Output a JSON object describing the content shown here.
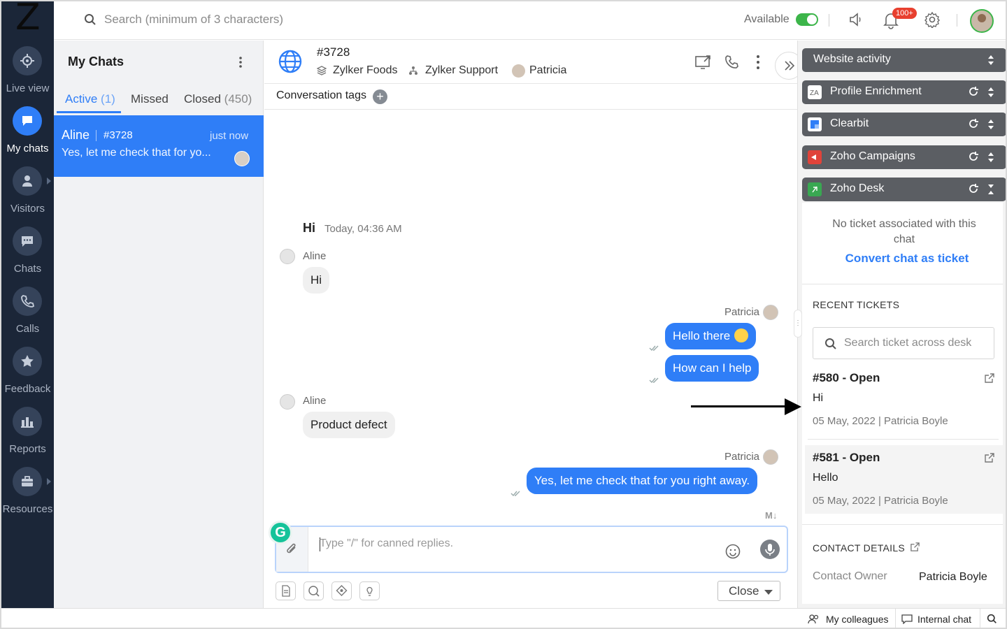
{
  "app": {
    "logo_letter": "Z"
  },
  "nav": {
    "items": [
      {
        "label": "Live view",
        "icon": "crosshair-icon"
      },
      {
        "label": "My chats",
        "icon": "chat-bubble-icon",
        "active": true
      },
      {
        "label": "Visitors",
        "icon": "person-icon"
      },
      {
        "label": "Chats",
        "icon": "chat-bubble-icon"
      },
      {
        "label": "Calls",
        "icon": "phone-icon"
      },
      {
        "label": "Feedback",
        "icon": "star-icon"
      },
      {
        "label": "Reports",
        "icon": "bar-chart-icon"
      },
      {
        "label": "Resources",
        "icon": "briefcase-icon"
      }
    ]
  },
  "topbar": {
    "search_placeholder": "Search (minimum of 3 characters)",
    "status_label": "Available",
    "status_on": true,
    "notification_badge": "100+"
  },
  "chatlist": {
    "title": "My Chats",
    "tabs": [
      {
        "label": "Active",
        "count": "(1)",
        "active": true
      },
      {
        "label": "Missed",
        "count": ""
      },
      {
        "label": "Closed",
        "count": "(450)"
      }
    ],
    "chats": [
      {
        "name": "Aline",
        "id": "#3728",
        "time": "just now",
        "preview": "Yes, let me check that for yo..."
      }
    ]
  },
  "conversation": {
    "id": "#3728",
    "brand": "Zylker Foods",
    "department": "Zylker Support",
    "agent": "Patricia",
    "tags_label": "Conversation tags",
    "day_greeting": "Hi",
    "day_time": "Today, 04:36 AM",
    "messages": [
      {
        "from": "Aline",
        "text": "Hi",
        "direction": "in"
      },
      {
        "from": "Patricia",
        "text": "Hello there",
        "direction": "out"
      },
      {
        "from": "Patricia",
        "text": "How can I help",
        "direction": "out"
      },
      {
        "from": "Aline",
        "text": "Product defect",
        "direction": "in"
      },
      {
        "from": "Patricia",
        "text": "Yes, let me check that for you right away.",
        "direction": "out"
      }
    ],
    "markdown_label": "M↓",
    "composer_placeholder": "Type \"/\" for canned replies.",
    "grammarly_letter": "G",
    "close_label": "Close"
  },
  "rightpanel": {
    "widgets": [
      {
        "label": "Website activity"
      },
      {
        "label": "Profile Enrichment",
        "icon_color": "#ffffff"
      },
      {
        "label": "Clearbit",
        "icon_color": "#2f7ef7"
      },
      {
        "label": "Zoho Campaigns",
        "icon_color": "#e0433a"
      },
      {
        "label": "Zoho Desk",
        "icon_color": "#39a852"
      }
    ],
    "desk": {
      "no_ticket_text": "No ticket associated with this chat",
      "convert_link": "Convert chat as ticket",
      "recent_title": "RECENT TICKETS",
      "search_placeholder": "Search ticket across desk",
      "tickets": [
        {
          "title": "#580 - Open",
          "subject": "Hi",
          "meta": "05 May, 2022 | Patricia Boyle"
        },
        {
          "title": "#581 - Open",
          "subject": "Hello",
          "meta": "05 May, 2022 | Patricia Boyle"
        }
      ],
      "contact_title": "CONTACT DETAILS",
      "contact_owner_label": "Contact Owner",
      "contact_owner_value": "Patricia Boyle"
    }
  },
  "footer": {
    "colleagues_label": "My colleagues",
    "internal_chat_label": "Internal chat"
  }
}
